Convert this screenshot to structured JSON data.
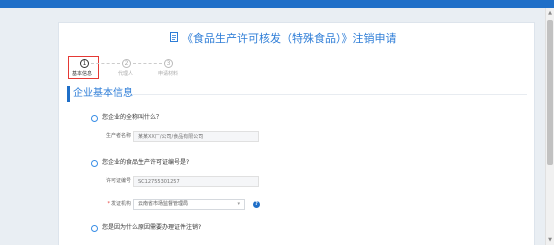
{
  "page": {
    "title": "《食品生产许可核发（特殊食品）》注销申请"
  },
  "steps": [
    {
      "number": "1",
      "label": "基本信息",
      "state": "active"
    },
    {
      "number": "2",
      "label": "代理人",
      "state": "inactive"
    },
    {
      "number": "3",
      "label": "申请材料",
      "state": "inactive"
    }
  ],
  "section": {
    "title": "企业基本信息"
  },
  "questions": [
    {
      "text": "您企业的全称叫什么？"
    },
    {
      "text": "您企业的食品生产许可证编号是?"
    },
    {
      "text": "您是因为什么原因需要办理证件注销?"
    }
  ],
  "fields": {
    "producer_name": {
      "label": "生产者名称",
      "placeholder": "某某XX厂/公司/食品有限公司"
    },
    "license_number": {
      "label": "许可证编号",
      "placeholder": "SC12755301257"
    },
    "issuing_authority": {
      "label": "发证机构",
      "value": "云南省市场监督管理局",
      "required": "*"
    }
  },
  "colors": {
    "brand": "#1f6fc8",
    "accent_text": "#2e7dd7",
    "highlight": "#e53935"
  }
}
